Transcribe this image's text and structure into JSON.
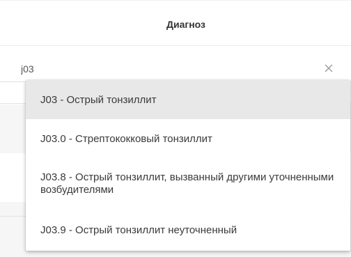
{
  "header": {
    "title": "Диагноз"
  },
  "diagnosis_input": {
    "value": "j03",
    "clear_icon": "close-icon"
  },
  "dropdown": {
    "options": [
      {
        "label": "J03 - Острый тонзиллит",
        "highlighted": true
      },
      {
        "label": "J03.0 - Стрептококковый тонзиллит",
        "highlighted": false
      },
      {
        "label": "J03.8 - Острый тонзиллит, вызванный другими уточненными возбудителями",
        "highlighted": false
      },
      {
        "label": "J03.9 - Острый тонзиллит неуточненный",
        "highlighted": false
      }
    ]
  },
  "colors": {
    "highlight": "#e8e8e8",
    "text": "#3a3a3a",
    "header_text": "#333333"
  }
}
